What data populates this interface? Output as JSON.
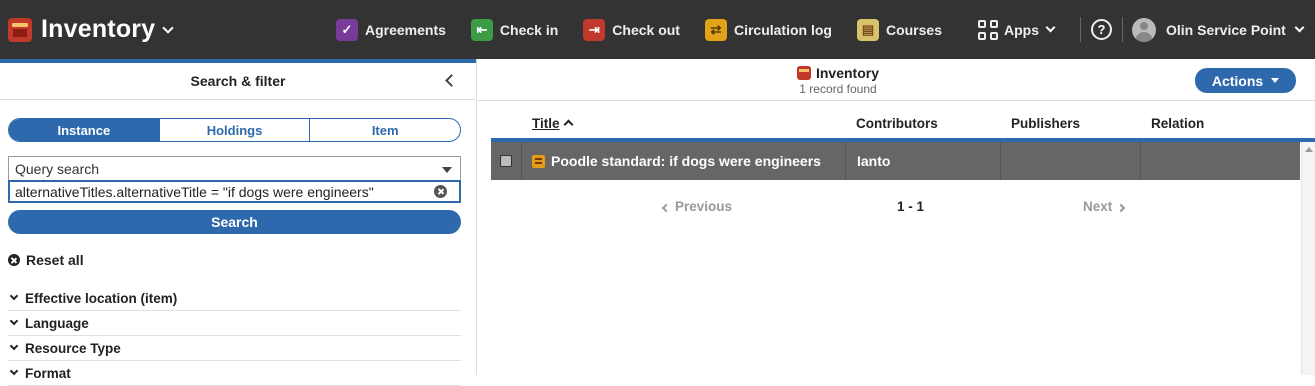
{
  "app": {
    "title": "Inventory"
  },
  "nav": {
    "items": [
      {
        "label": "Agreements",
        "icon": "agreements-icon"
      },
      {
        "label": "Check in",
        "icon": "check-in-icon"
      },
      {
        "label": "Check out",
        "icon": "check-out-icon"
      },
      {
        "label": "Circulation log",
        "icon": "circulation-log-icon"
      },
      {
        "label": "Courses",
        "icon": "courses-icon"
      }
    ],
    "apps_label": "Apps",
    "help_symbol": "?",
    "user_label": "Olin Service Point"
  },
  "filter_pane": {
    "title": "Search & filter",
    "segments": [
      "Instance",
      "Holdings",
      "Item"
    ],
    "active_segment": "Instance",
    "search_option": "Query search",
    "query_value": "alternativeTitles.alternativeTitle = \"if dogs were engineers\"",
    "search_button": "Search",
    "reset_label": "Reset all",
    "facets": [
      "Effective location (item)",
      "Language",
      "Resource Type",
      "Format"
    ]
  },
  "results_pane": {
    "title": "Inventory",
    "subtitle": "1 record found",
    "actions_label": "Actions",
    "columns": [
      "Title",
      "Contributors",
      "Publishers",
      "Relation"
    ],
    "sort_column": "Title",
    "rows": [
      {
        "title": "Poodle standard: if dogs were engineers",
        "contributors": "Ianto",
        "publishers": "",
        "relation": ""
      }
    ],
    "pager": {
      "previous": "Previous",
      "range": "1 - 1",
      "next": "Next"
    }
  },
  "colors": {
    "topbar": "#333333",
    "accent": "#2f69ad",
    "selected_row": "#666666"
  }
}
